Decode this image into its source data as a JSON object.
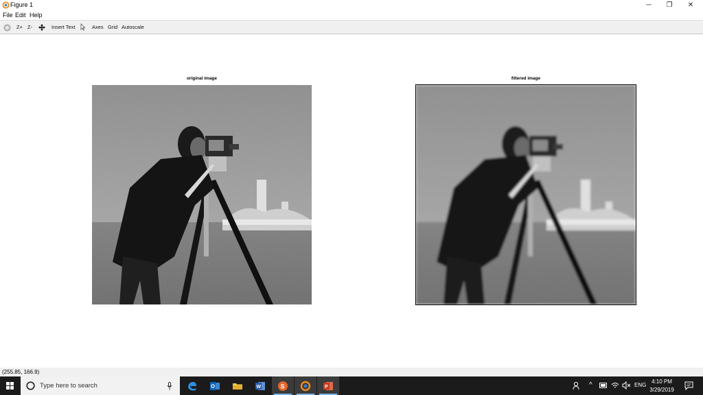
{
  "window": {
    "title": "Figure 1",
    "controls": {
      "minimize": "─",
      "maximize": "❐",
      "close": "✕"
    }
  },
  "menu": [
    "File",
    "Edit",
    "Help"
  ],
  "toolbar": {
    "zoom_in": "Z+",
    "zoom_out": "Z-",
    "insert_text": "Insert Text",
    "axes": "Axes",
    "grid": "Grid",
    "autoscale": "Autoscale"
  },
  "plots": {
    "left_title": "original image",
    "right_title": "filtered image"
  },
  "status": {
    "coords": "(255.85, 166.9)"
  },
  "taskbar": {
    "search_placeholder": "Type here to search",
    "lang": "ENG",
    "time": "4:10 PM",
    "date": "3/29/2019",
    "apps": [
      "edge-icon",
      "outlook-icon",
      "file-explorer-icon",
      "word-icon",
      "snagit-icon",
      "octave-icon",
      "powerpoint-icon"
    ]
  }
}
